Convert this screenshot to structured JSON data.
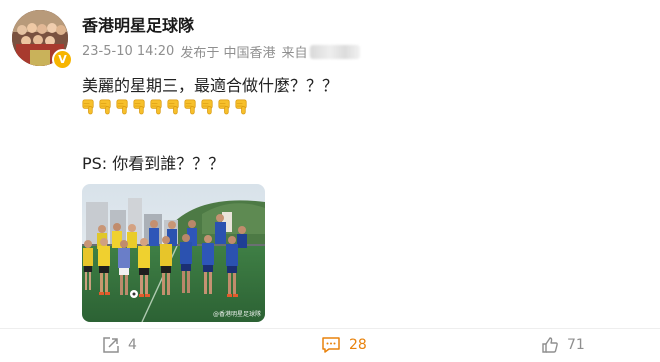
{
  "post": {
    "author": "香港明星足球隊",
    "date": "23-5-10 14:20",
    "publish_label": "发布于 中国香港",
    "source_label": "来自",
    "lines": [
      "美麗的星期三，最適合做什麼？？？",
      "PS: 你看到誰？？？"
    ],
    "emoji": {
      "icon": "point-down-hand",
      "count": 10
    },
    "photo_watermark": "@香港明星足球隊"
  },
  "actions": {
    "share_count": "4",
    "comment_count": "28",
    "like_count": "71"
  },
  "colors": {
    "accent_comment": "#e8820c",
    "verified_badge": "#f7b500"
  }
}
